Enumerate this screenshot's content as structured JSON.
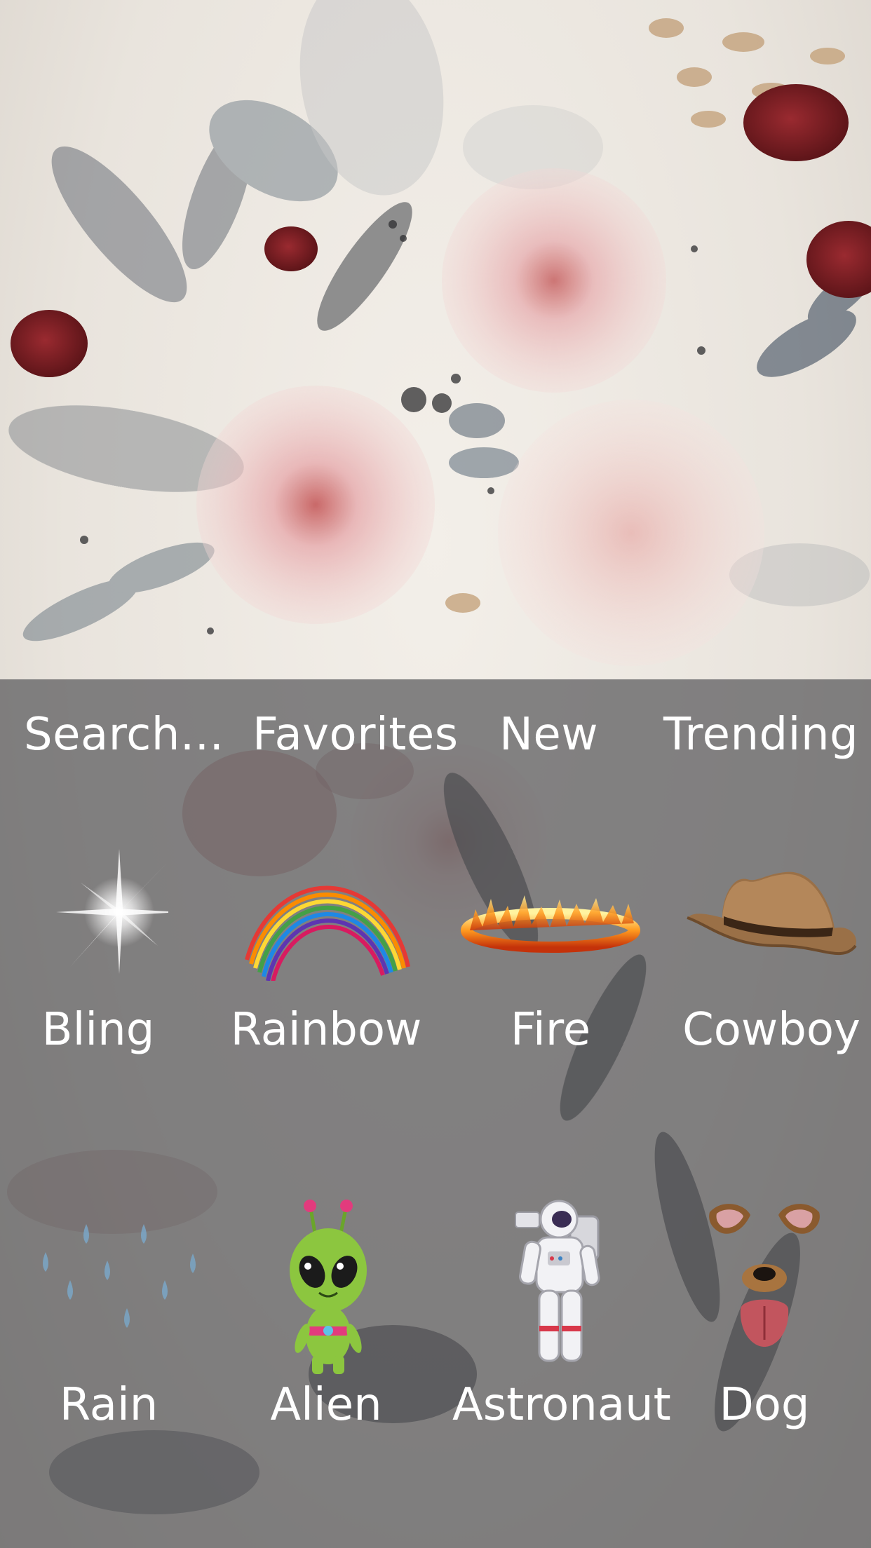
{
  "tabs": [
    {
      "label": "Search..."
    },
    {
      "label": "Favorites"
    },
    {
      "label": "New"
    },
    {
      "label": "Trending"
    }
  ],
  "filters": [
    {
      "label": "Bling",
      "icon": "sparkle-icon"
    },
    {
      "label": "Rainbow",
      "icon": "rainbow-icon"
    },
    {
      "label": "Fire",
      "icon": "fire-ring-icon"
    },
    {
      "label": "Cowboy",
      "icon": "cowboy-hat-icon"
    },
    {
      "label": "Rain",
      "icon": "raindrops-icon"
    },
    {
      "label": "Alien",
      "icon": "alien-icon"
    },
    {
      "label": "Astronaut",
      "icon": "astronaut-icon"
    },
    {
      "label": "Dog",
      "icon": "dog-face-icon"
    }
  ],
  "colors": {
    "panel": "#58585a",
    "text": "#ffffff",
    "alien": "#8cc63f",
    "rose": "#e9b9b8",
    "berry": "#7a1f24",
    "leaf": "#5c6670"
  }
}
